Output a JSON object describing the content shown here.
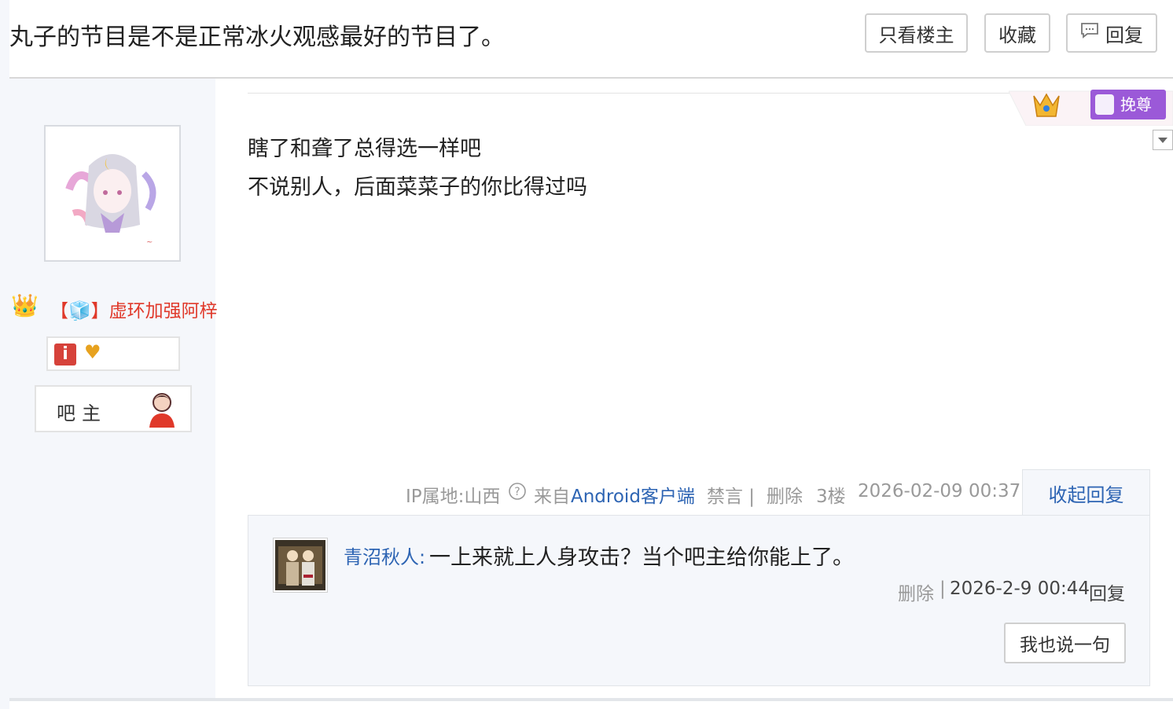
{
  "header": {
    "title": "丸子的节目是不是正常冰火观感最好的节目了。",
    "buttons": {
      "only_op": "只看楼主",
      "favorite": "收藏",
      "reply": "回复"
    }
  },
  "post": {
    "author": {
      "name": "【🧊】虚环加强阿梓",
      "role": "吧主"
    },
    "content": [
      "瞎了和聋了总得选一样吧",
      "不说别人，后面菜菜子的你比得过吗"
    ],
    "honor_badge": "挽尊",
    "meta": {
      "ip": "IP属地:山西",
      "from_prefix": "来自",
      "client": "Android客户端",
      "ban": "禁言 |",
      "delete": "删除",
      "floor": "3楼",
      "time": "2026-02-09 00:37",
      "collapse_replies": "收起回复"
    }
  },
  "reply": {
    "user": "青沼秋人:",
    "text": "一上来就上人身攻击？当个吧主给你能上了。",
    "delete": "删除",
    "separator": "|",
    "time": "2026-2-9 00:44",
    "reply_label": "回复",
    "say_button": "我也说一句"
  }
}
